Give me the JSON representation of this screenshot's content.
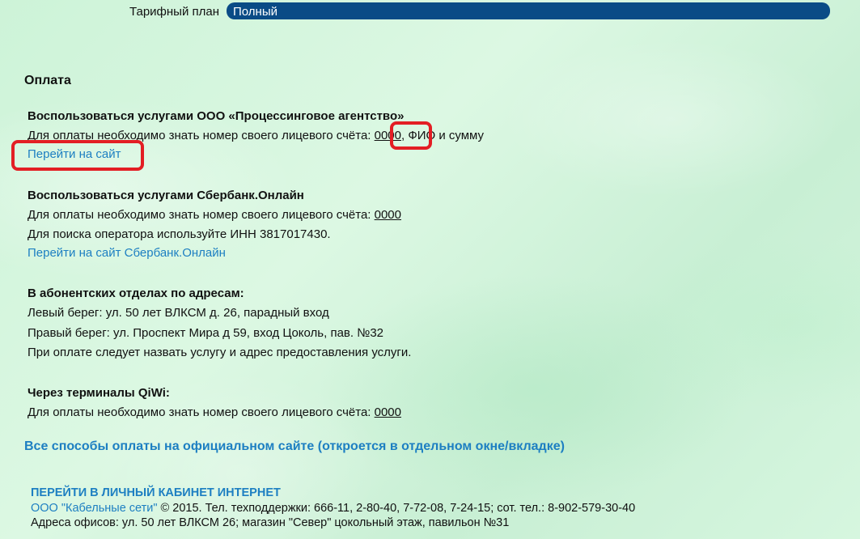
{
  "tariff": {
    "label": "Тарифный план",
    "value": "Полный"
  },
  "payment": {
    "heading": "Оплата",
    "sections": [
      {
        "title": "Воспользоваться услугами ООО «Процессинговое агентство»",
        "line_prefix": "Для оплаты необходимо знать номер своего лицевого счёта:",
        "account": "0000",
        "line_suffix": ", ФИО и сумму",
        "link": "Перейти на сайт"
      },
      {
        "title": "Воспользоваться услугами Сбербанк.Онлайн",
        "line_prefix": "Для оплаты необходимо знать номер своего лицевого счёта:",
        "account": "0000",
        "extra": "Для поиска оператора используйте ИНН 3817017430.",
        "link": "Перейти на сайт Сбербанк.Онлайн"
      },
      {
        "title": "В абонентских отделах по адресам:",
        "lines": [
          "Левый берег: ул. 50 лет ВЛКСМ д. 26, парадный вход",
          "Правый берег: ул. Проспект Мира д 59, вход Цоколь, пав. №32",
          "При оплате следует назвать услугу и адрес предоставления услуги."
        ]
      },
      {
        "title": "Через терминалы QiWi:",
        "line_prefix": "Для оплаты необходимо знать номер своего лицевого счёта:",
        "account": "0000"
      }
    ],
    "all_methods_link": "Все способы оплаты на официальном сайте (откроется в отдельном окне/вкладке)"
  },
  "footer": {
    "cabinet_link": "ПЕРЕЙТИ В ЛИЧНЫЙ КАБИНЕТ ИНТЕРНЕТ",
    "company_link": "ООО \"Кабельные сети\"",
    "line1_rest": " © 2015. Тел. техподдержки: 666-11, 2-80-40, 7-72-08, 7-24-15; сот. тел.: 8-902-579-30-40",
    "line2": "Адреса офисов: ул. 50 лет ВЛКСМ 26; магазин \"Север\" цокольный этаж, павильон №31"
  },
  "colors": {
    "background": "#d2f5dc",
    "link": "#1d7fc2",
    "tariff_box": "#0a4b86",
    "highlight": "#e31e24"
  }
}
